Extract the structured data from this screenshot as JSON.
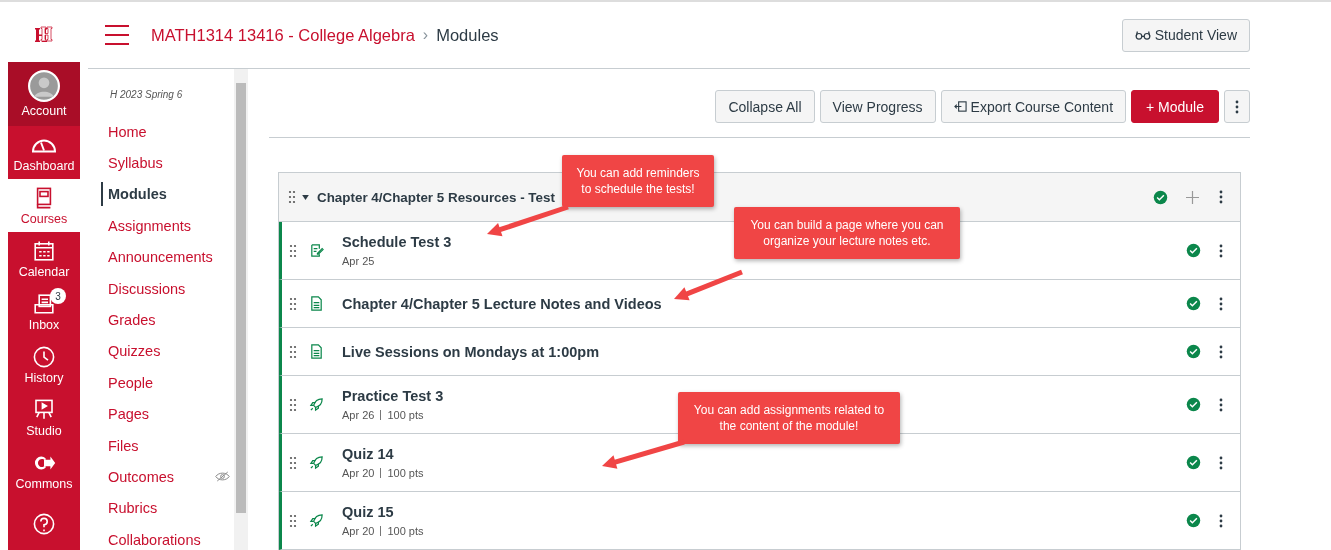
{
  "global_nav": [
    {
      "label": "Account",
      "selected": false
    },
    {
      "label": "Dashboard",
      "selected": false
    },
    {
      "label": "Courses",
      "selected": true
    },
    {
      "label": "Calendar",
      "selected": false
    },
    {
      "label": "Inbox",
      "selected": false,
      "badge": "3"
    },
    {
      "label": "History",
      "selected": false
    },
    {
      "label": "Studio",
      "selected": false
    },
    {
      "label": "Commons",
      "selected": false
    },
    {
      "selected": false
    }
  ],
  "breadcrumb": {
    "course": "MATH1314 13416 - College Algebra",
    "separator": "›",
    "page": "Modules"
  },
  "student_view_button": "Student View",
  "course_nav": {
    "term": "H 2023 Spring 6",
    "items": [
      {
        "label": "Home",
        "selected": false,
        "hidden": false
      },
      {
        "label": "Syllabus",
        "selected": false,
        "hidden": false
      },
      {
        "label": "Modules",
        "selected": true,
        "hidden": false
      },
      {
        "label": "Assignments",
        "selected": false,
        "hidden": false
      },
      {
        "label": "Announcements",
        "selected": false,
        "hidden": false
      },
      {
        "label": "Discussions",
        "selected": false,
        "hidden": false
      },
      {
        "label": "Grades",
        "selected": false,
        "hidden": false
      },
      {
        "label": "Quizzes",
        "selected": false,
        "hidden": false
      },
      {
        "label": "People",
        "selected": false,
        "hidden": false
      },
      {
        "label": "Pages",
        "selected": false,
        "hidden": false
      },
      {
        "label": "Files",
        "selected": false,
        "hidden": false
      },
      {
        "label": "Outcomes",
        "selected": false,
        "hidden": true
      },
      {
        "label": "Rubrics",
        "selected": false,
        "hidden": false
      },
      {
        "label": "Collaborations",
        "selected": false,
        "hidden": false
      }
    ]
  },
  "toolbar": {
    "buttons": [
      "Collapse All",
      "View Progress",
      "Export Course Content"
    ],
    "add_module": "+ Module"
  },
  "module": {
    "title": "Chapter 4/Chapter 5 Resources - Test",
    "expanded": true,
    "published": true,
    "items": [
      {
        "kind": "assignment",
        "title": "Schedule Test 3",
        "meta": [
          "Apr 25"
        ],
        "published": true
      },
      {
        "kind": "page",
        "title": "Chapter 4/Chapter 5 Lecture Notes and Videos",
        "published": true
      },
      {
        "kind": "page",
        "title": "Live Sessions on Mondays at 1:00pm",
        "published": true
      },
      {
        "kind": "quiz",
        "title": "Practice Test 3",
        "meta": [
          "Apr 26",
          "100 pts"
        ],
        "published": true
      },
      {
        "kind": "quiz",
        "title": "Quiz 14",
        "meta": [
          "Apr 20",
          "100 pts"
        ],
        "published": true
      },
      {
        "kind": "quiz",
        "title": "Quiz 15",
        "meta": [
          "Apr 20",
          "100 pts"
        ],
        "published": true
      }
    ]
  },
  "annotations": [
    {
      "text": "You can add reminders to schedule the tests!"
    },
    {
      "text": "You can build a page where you can organize your lecture notes etc."
    },
    {
      "text": "You can add assignments related to the content of the module!"
    }
  ]
}
